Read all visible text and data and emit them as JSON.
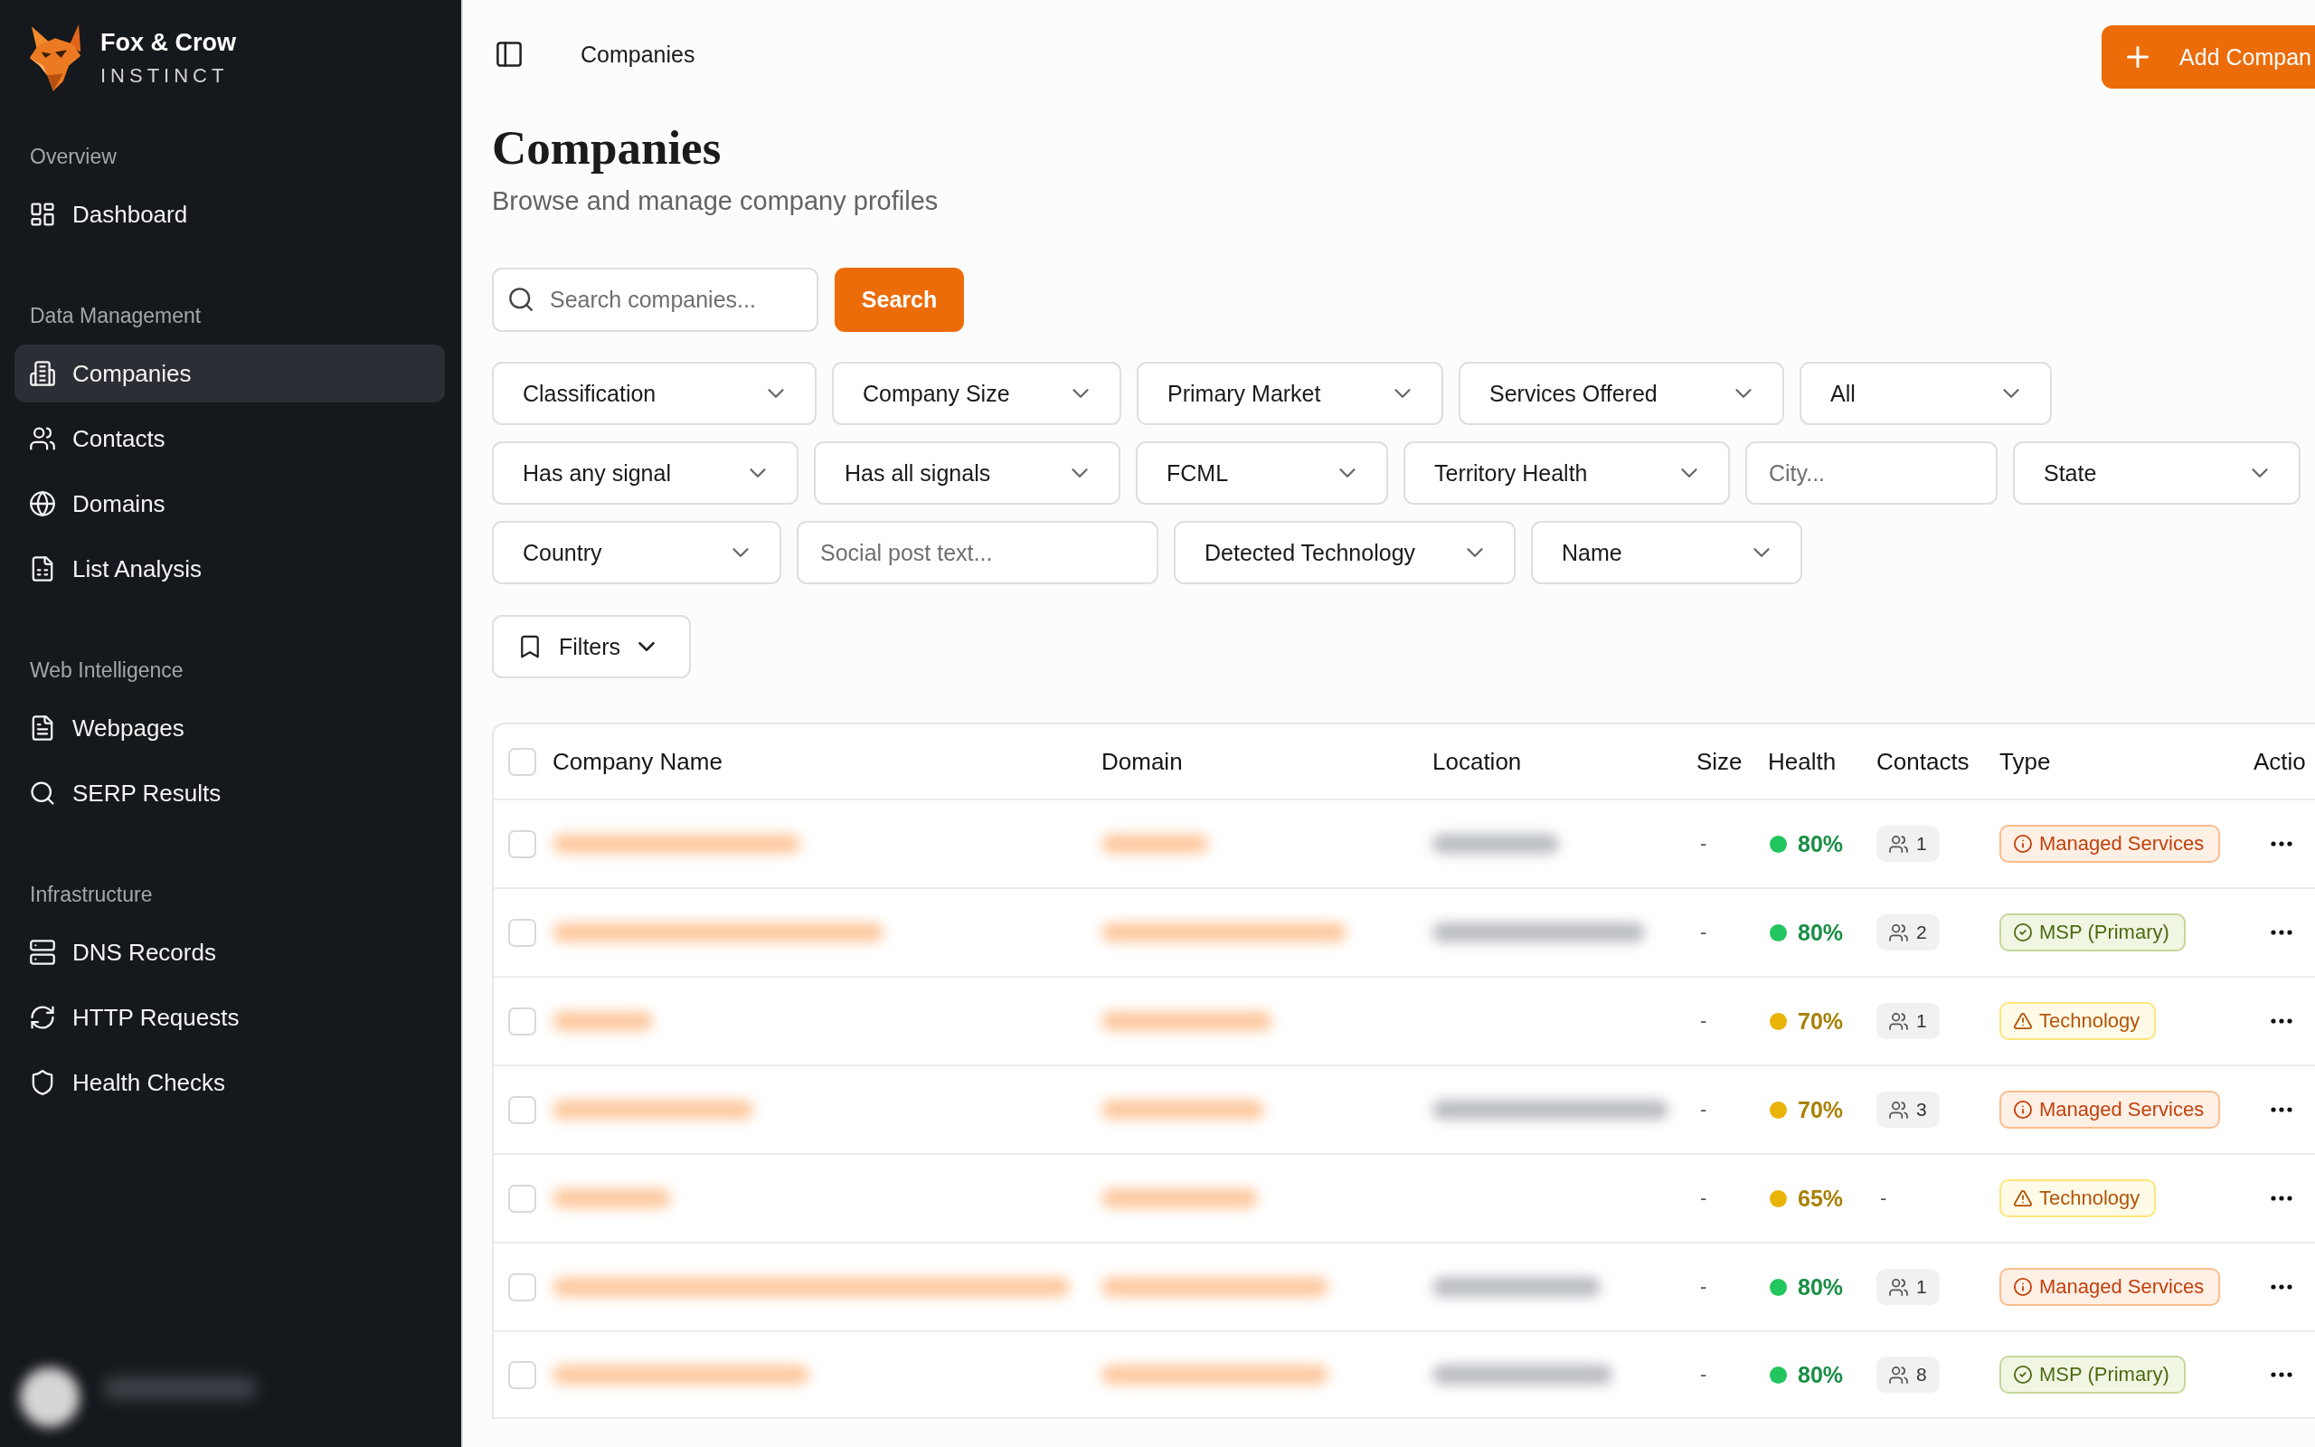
{
  "sidebar": {
    "brand": {
      "name": "Fox & Crow",
      "tagline": "INSTINCT"
    },
    "sections": [
      {
        "title": "Overview",
        "items": [
          {
            "label": "Dashboard",
            "selected": false
          }
        ]
      },
      {
        "title": "Data Management",
        "items": [
          {
            "label": "Companies",
            "selected": true
          },
          {
            "label": "Contacts",
            "selected": false
          },
          {
            "label": "Domains",
            "selected": false
          },
          {
            "label": "List Analysis",
            "selected": false
          }
        ]
      },
      {
        "title": "Web Intelligence",
        "items": [
          {
            "label": "Webpages",
            "selected": false
          },
          {
            "label": "SERP Results",
            "selected": false
          }
        ]
      },
      {
        "title": "Infrastructure",
        "items": [
          {
            "label": "DNS Records",
            "selected": false
          },
          {
            "label": "HTTP Requests",
            "selected": false
          },
          {
            "label": "Health Checks",
            "selected": false
          }
        ]
      }
    ]
  },
  "topbar": {
    "breadcrumb": "Companies",
    "action_button": "Add Compan"
  },
  "page": {
    "title": "Companies",
    "subtitle": "Browse and manage company profiles"
  },
  "search": {
    "placeholder": "Search companies...",
    "button": "Search"
  },
  "filters": [
    {
      "kind": "select",
      "label": "Classification"
    },
    {
      "kind": "select",
      "label": "Company Size"
    },
    {
      "kind": "select",
      "label": "Primary Market"
    },
    {
      "kind": "select",
      "label": "Services Offered"
    },
    {
      "kind": "select",
      "label": "All"
    },
    {
      "kind": "select",
      "label": "Has any signal"
    },
    {
      "kind": "select",
      "label": "Has all signals"
    },
    {
      "kind": "select",
      "label": "FCML"
    },
    {
      "kind": "select",
      "label": "Territory Health"
    },
    {
      "kind": "input",
      "placeholder": "City..."
    },
    {
      "kind": "select",
      "label": "State"
    },
    {
      "kind": "select",
      "label": "Country"
    },
    {
      "kind": "input",
      "placeholder": "Social post text..."
    },
    {
      "kind": "select",
      "label": "Detected Technology"
    },
    {
      "kind": "select",
      "label": "Name"
    }
  ],
  "saved_filters_button": "Filters",
  "table": {
    "all_checked": false,
    "columns": [
      "Company Name",
      "Domain",
      "Location",
      "Size",
      "Health",
      "Contacts",
      "Type",
      "Actio"
    ],
    "rows": [
      {
        "checked": false,
        "name_blurred": true,
        "domain_blurred": true,
        "location_blurred": true,
        "size": "-",
        "health": {
          "text": "80%",
          "color": "#22c55e"
        },
        "contacts": {
          "kind": "badge",
          "text": "1"
        },
        "type": {
          "kind": "service",
          "text": "Managed Services"
        }
      },
      {
        "checked": false,
        "name_blurred": true,
        "domain_blurred": true,
        "location_blurred": true,
        "size": "-",
        "health": {
          "text": "80%",
          "color": "#22c55e"
        },
        "contacts": {
          "kind": "badge",
          "text": "2"
        },
        "type": {
          "kind": "msp",
          "text": "MSP (Primary)"
        }
      },
      {
        "checked": false,
        "name_blurred": true,
        "domain_blurred": true,
        "location_blurred": false,
        "size": "-",
        "health": {
          "text": "70%",
          "color": "#eab308"
        },
        "contacts": {
          "kind": "badge",
          "text": "1"
        },
        "type": {
          "kind": "technology",
          "text": "Technology"
        }
      },
      {
        "checked": false,
        "name_blurred": true,
        "domain_blurred": true,
        "location_blurred": true,
        "size": "-",
        "health": {
          "text": "70%",
          "color": "#eab308"
        },
        "contacts": {
          "kind": "badge",
          "text": "3"
        },
        "type": {
          "kind": "service",
          "text": "Managed Services"
        }
      },
      {
        "checked": false,
        "name_blurred": true,
        "domain_blurred": true,
        "location_blurred": false,
        "size": "-",
        "health": {
          "text": "65%",
          "color": "#eab308"
        },
        "contacts": {
          "kind": "empty",
          "text": "-"
        },
        "type": {
          "kind": "technology",
          "text": "Technology"
        }
      },
      {
        "checked": false,
        "name_blurred": true,
        "domain_blurred": true,
        "location_blurred": true,
        "size": "-",
        "health": {
          "text": "80%",
          "color": "#22c55e"
        },
        "contacts": {
          "kind": "badge",
          "text": "1"
        },
        "type": {
          "kind": "service",
          "text": "Managed Services"
        }
      },
      {
        "checked": false,
        "name_blurred": true,
        "domain_blurred": true,
        "location_blurred": true,
        "size": "-",
        "health": {
          "text": "80%",
          "color": "#22c55e"
        },
        "contacts": {
          "kind": "badge",
          "text": "8"
        },
        "type": {
          "kind": "msp",
          "text": "MSP (Primary)"
        }
      }
    ]
  }
}
